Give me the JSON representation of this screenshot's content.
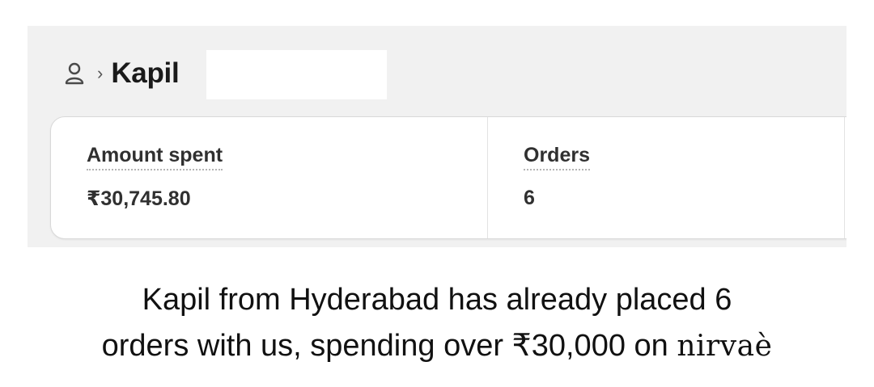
{
  "breadcrumb": {
    "icon": "person-icon",
    "separator": "›",
    "customer_name": "Kapil"
  },
  "metrics": [
    {
      "label": "Amount spent",
      "value": "₹30,745.80"
    },
    {
      "label": "Orders",
      "value": "6"
    }
  ],
  "caption": {
    "line1": "Kapil from Hyderabad has already placed 6",
    "line2": "orders with us, spending over ₹30,000 on",
    "brand": "nirvaè"
  },
  "colors": {
    "panel_bg": "#f1f1f1",
    "card_border": "#d9d9d9",
    "text_primary": "#303030"
  }
}
